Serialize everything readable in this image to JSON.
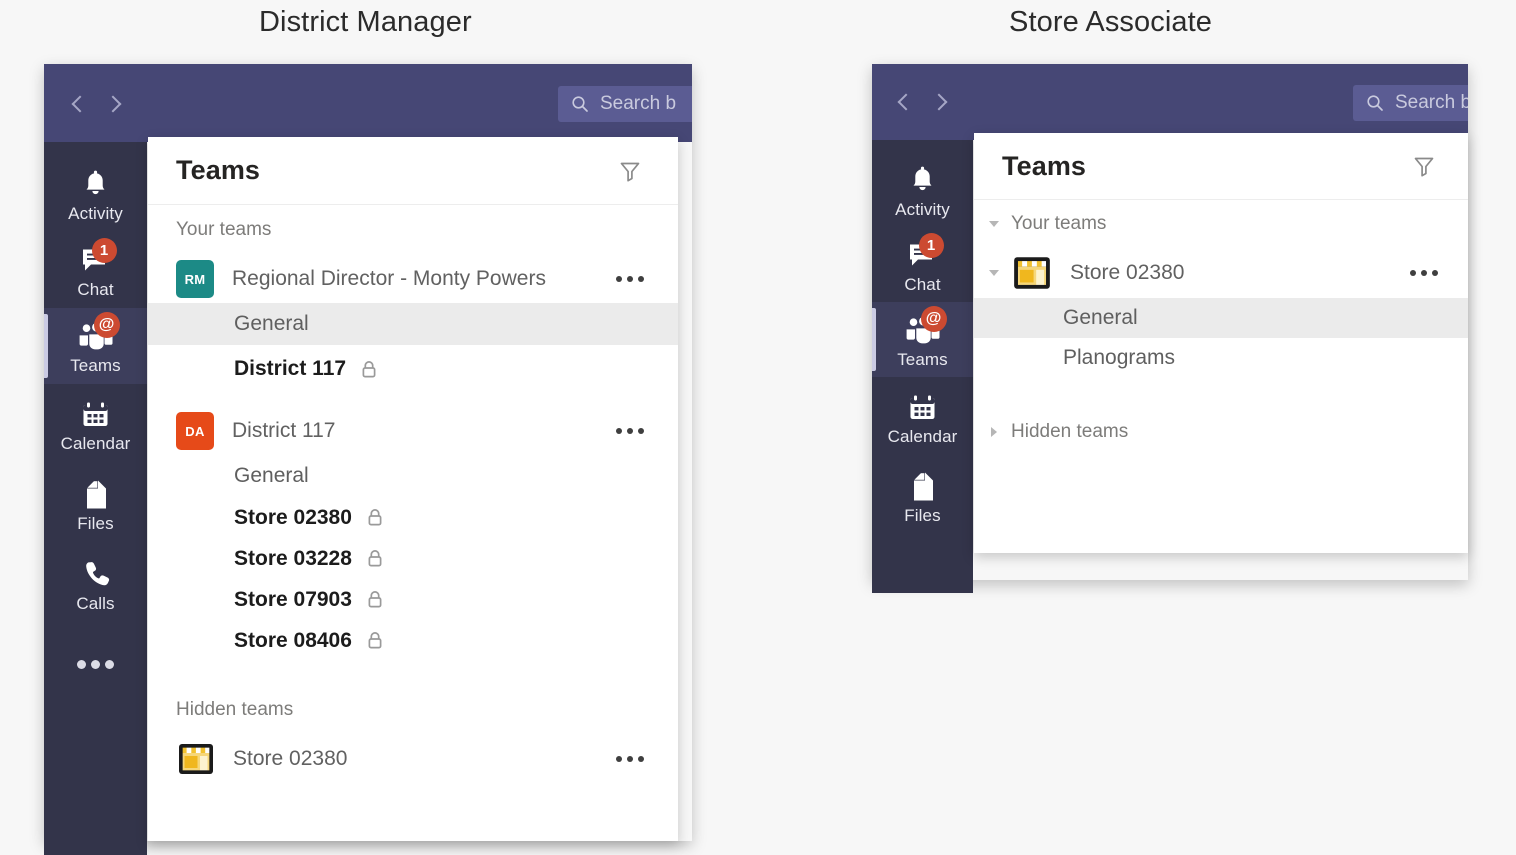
{
  "captions": {
    "district_manager": "District Manager",
    "store_associate": "Store Associate"
  },
  "colors": {
    "topbar": "#464775",
    "rail": "#33344a",
    "rail_active": "#3d3e5c",
    "badge": "#cc4a31",
    "avatar_teal": "#1c8a86",
    "avatar_orange": "#e64a19",
    "selected_row": "#ebebeb",
    "page_background": "#f7f7f7"
  },
  "windows": [
    {
      "id": "district-manager",
      "search": {
        "placeholder": "Search b",
        "icon": "search-icon"
      },
      "nav": {
        "back": "back-arrow",
        "forward": "forward-arrow"
      },
      "rail": [
        {
          "label": "Activity",
          "icon": "bell-icon",
          "badge": null,
          "active": false
        },
        {
          "label": "Chat",
          "icon": "chat-icon",
          "badge": "1",
          "active": false
        },
        {
          "label": "Teams",
          "icon": "teams-icon",
          "badge": "@",
          "active": true
        },
        {
          "label": "Calendar",
          "icon": "calendar-icon",
          "badge": null,
          "active": false
        },
        {
          "label": "Files",
          "icon": "files-icon",
          "badge": null,
          "active": false
        },
        {
          "label": "Calls",
          "icon": "calls-icon",
          "badge": null,
          "active": false
        }
      ],
      "rail_overflow": "more-options-icon",
      "panel": {
        "title": "Teams",
        "filter_icon": "filter-funnel-icon",
        "sections": [
          {
            "label": "Your teams",
            "chevron": null,
            "teams": [
              {
                "name": "Regional Director - Monty Powers",
                "avatar_text": "RM",
                "avatar_color": "#1c8a86",
                "avatar_type": "initials",
                "chevron": null,
                "more": "more-options-icon",
                "channels": [
                  {
                    "name": "General",
                    "private": false,
                    "selected": true,
                    "bold": false
                  },
                  {
                    "name": "District 117",
                    "private": true,
                    "selected": false,
                    "bold": true
                  }
                ]
              },
              {
                "name": "District 117",
                "avatar_text": "DA",
                "avatar_color": "#e64a19",
                "avatar_type": "initials",
                "chevron": null,
                "more": "more-options-icon",
                "channels": [
                  {
                    "name": "General",
                    "private": false,
                    "selected": false,
                    "bold": false
                  },
                  {
                    "name": "Store 02380",
                    "private": true,
                    "selected": false,
                    "bold": true
                  },
                  {
                    "name": "Store 03228",
                    "private": true,
                    "selected": false,
                    "bold": true
                  },
                  {
                    "name": "Store 07903",
                    "private": true,
                    "selected": false,
                    "bold": true
                  },
                  {
                    "name": "Store 08406",
                    "private": true,
                    "selected": false,
                    "bold": true
                  }
                ]
              }
            ]
          },
          {
            "label": "Hidden teams",
            "chevron": null,
            "teams": [
              {
                "name": "Store 02380",
                "avatar_text": "",
                "avatar_color": "",
                "avatar_type": "storefront",
                "chevron": null,
                "more": "more-options-icon",
                "channels": []
              }
            ]
          }
        ]
      }
    },
    {
      "id": "store-associate",
      "search": {
        "placeholder": "Search b",
        "icon": "search-icon"
      },
      "nav": {
        "back": "back-arrow",
        "forward": "forward-arrow"
      },
      "rail": [
        {
          "label": "Activity",
          "icon": "bell-icon",
          "badge": null,
          "active": false
        },
        {
          "label": "Chat",
          "icon": "chat-icon",
          "badge": "1",
          "active": false
        },
        {
          "label": "Teams",
          "icon": "teams-icon",
          "badge": "@",
          "active": true
        },
        {
          "label": "Calendar",
          "icon": "calendar-icon",
          "badge": null,
          "active": false
        },
        {
          "label": "Files",
          "icon": "files-icon",
          "badge": null,
          "active": false
        }
      ],
      "rail_overflow": null,
      "panel": {
        "title": "Teams",
        "filter_icon": "filter-funnel-icon",
        "sections": [
          {
            "label": "Your teams",
            "chevron": "down",
            "teams": [
              {
                "name": "Store 02380",
                "avatar_text": "",
                "avatar_color": "",
                "avatar_type": "storefront",
                "chevron": "down",
                "more": "more-options-icon",
                "channels": [
                  {
                    "name": "General",
                    "private": false,
                    "selected": true,
                    "bold": false
                  },
                  {
                    "name": "Planograms",
                    "private": false,
                    "selected": false,
                    "bold": false
                  }
                ]
              }
            ]
          },
          {
            "label": "Hidden teams",
            "chevron": "right",
            "teams": []
          }
        ]
      }
    }
  ]
}
